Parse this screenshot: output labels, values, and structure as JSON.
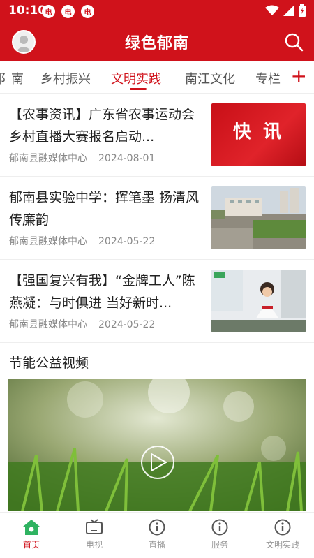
{
  "status_bar": {
    "time": "10:10",
    "badges": [
      "电",
      "电",
      "电"
    ]
  },
  "header": {
    "title": "绿色郁南",
    "avatar_icon": "avatar-icon",
    "search_icon": "search-icon"
  },
  "tabs": {
    "items": [
      {
        "label": "阝南",
        "active": false
      },
      {
        "label": "乡村振兴",
        "active": false
      },
      {
        "label": "文明实践",
        "active": true
      },
      {
        "label": "南江文化",
        "active": false
      },
      {
        "label": "专栏",
        "active": false
      }
    ],
    "add_icon": "plus-icon"
  },
  "news": [
    {
      "title": "【农事资讯】广东省农事运动会乡村直播大赛报名启动...",
      "source": "郁南县融媒体中心",
      "date": "2024-08-01",
      "thumb_text": "快 讯"
    },
    {
      "title": "郁南县实验中学：挥笔墨 扬清风 传廉韵",
      "source": "郁南县融媒体中心",
      "date": "2024-05-22"
    },
    {
      "title": "【强国复兴有我】“金牌工人”陈燕凝：与时俱进 当好新时...",
      "source": "郁南县融媒体中心",
      "date": "2024-05-22"
    }
  ],
  "section": {
    "title": "节能公益视频"
  },
  "bottom_nav": [
    {
      "label": "首页",
      "icon": "home-icon",
      "active": true
    },
    {
      "label": "电视",
      "icon": "tv-icon",
      "active": false
    },
    {
      "label": "直播",
      "icon": "info-icon",
      "active": false
    },
    {
      "label": "服务",
      "icon": "info-icon",
      "active": false
    },
    {
      "label": "文明实践",
      "icon": "info-icon",
      "active": false
    }
  ],
  "colors": {
    "brand_red": "#d0121b",
    "active_green": "#2fb361"
  }
}
